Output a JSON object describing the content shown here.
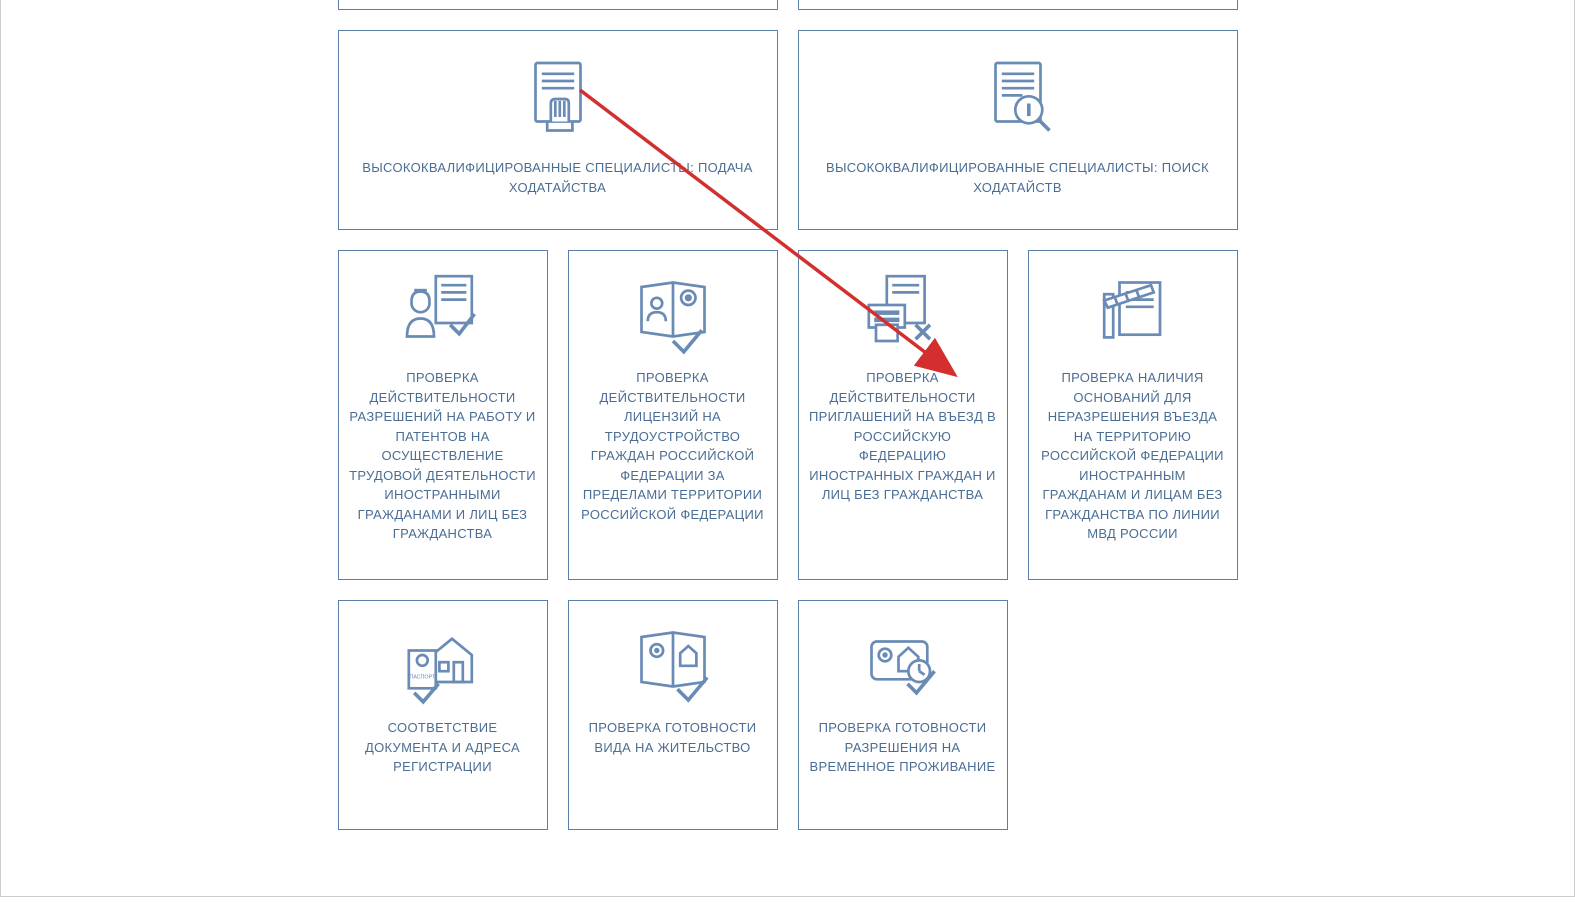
{
  "colors": {
    "card_border": "#5b7fa8",
    "text": "#4a6d94",
    "icon_stroke": "#6a8bb5",
    "arrow": "#d32f2f"
  },
  "row_top_partial": {
    "left_label": "",
    "right_label": ""
  },
  "row_specialists": {
    "left": {
      "label": "ВЫСОКОКВАЛИФИЦИРОВАННЫЕ СПЕЦИАЛИСТЫ: ПОДАЧА ХОДАТАЙСТВА",
      "icon": "document-hand-icon"
    },
    "right": {
      "label": "ВЫСОКОКВАЛИФИЦИРОВАННЫЕ СПЕЦИАЛИСТЫ: ПОИСК ХОДАТАЙСТВ",
      "icon": "document-search-icon"
    }
  },
  "row_checks": [
    {
      "label": "ПРОВЕРКА ДЕЙСТВИТЕЛЬНОСТИ РАЗРЕШЕНИЙ НА РАБОТУ И ПАТЕНТОВ НА ОСУЩЕСТВЛЕНИЕ ТРУДОВОЙ ДЕЯТЕЛЬНОСТИ ИНОСТРАННЫМИ ГРАЖДАНАМИ И ЛИЦ БЕЗ ГРАЖДАНСТВА",
      "icon": "worker-document-check-icon"
    },
    {
      "label": "ПРОВЕРКА ДЕЙСТВИТЕЛЬНОСТИ ЛИЦЕНЗИЙ НА ТРУДОУСТРОЙСТВО ГРАЖДАН РОССИЙСКОЙ ФЕДЕРАЦИИ ЗА ПРЕДЕЛАМИ ТЕРРИТОРИИ РОССИЙСКОЙ ФЕДЕРАЦИИ",
      "icon": "passport-check-icon"
    },
    {
      "label": "ПРОВЕРКА ДЕЙСТВИТЕЛЬНОСТИ ПРИГЛАШЕНИЙ НА ВЪЕЗД В РОССИЙСКУЮ ФЕДЕРАЦИЮ ИНОСТРАННЫХ ГРАЖДАН И ЛИЦ БЕЗ ГРАЖДАНСТВА",
      "icon": "document-print-denied-icon"
    },
    {
      "label": "ПРОВЕРКА НАЛИЧИЯ ОСНОВАНИЙ ДЛЯ НЕРАЗРЕШЕНИЯ ВЪЕЗДА НА ТЕРРИТОРИЮ РОССИЙСКОЙ ФЕДЕРАЦИИ ИНОСТРАННЫМ ГРАЖДАНАМ И ЛИЦАМ БЕЗ ГРАЖДАНСТВА ПО ЛИНИИ МВД РОССИИ",
      "icon": "document-barrier-icon"
    }
  ],
  "row_bottom": [
    {
      "label": "СООТВЕТСТВИЕ ДОКУМЕНТА И АДРЕСА РЕГИСТРАЦИИ",
      "icon": "passport-house-icon"
    },
    {
      "label": "ПРОВЕРКА ГОТОВНОСТИ ВИДА НА ЖИТЕЛЬСТВО",
      "icon": "book-emblem-check-icon"
    },
    {
      "label": "ПРОВЕРКА ГОТОВНОСТИ РАЗРЕШЕНИЯ НА ВРЕМЕННОЕ ПРОЖИВАНИЕ",
      "icon": "card-house-clock-icon"
    }
  ],
  "annotation_arrow": {
    "from": "row_specialists.left area",
    "to": "row_checks.3",
    "color": "#d32f2f"
  }
}
